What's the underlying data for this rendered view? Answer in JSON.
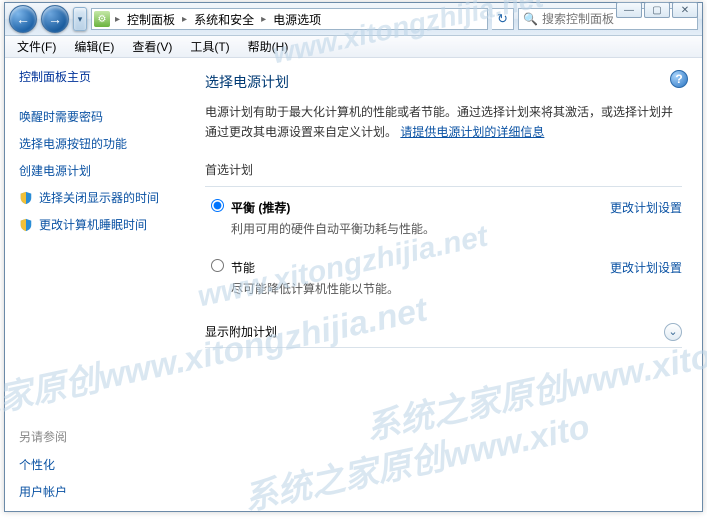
{
  "window_controls": {
    "min": "—",
    "max": "▢",
    "close": "✕"
  },
  "nav": {
    "back_glyph": "←",
    "fwd_glyph": "→",
    "drop_glyph": "▾",
    "breadcrumb": [
      "控制面板",
      "系统和安全",
      "电源选项"
    ],
    "sep": "▸",
    "refresh_glyph": "↻"
  },
  "search": {
    "placeholder": "搜索控制面板"
  },
  "menu": {
    "file": "文件(F)",
    "edit": "编辑(E)",
    "view": "查看(V)",
    "tools": "工具(T)",
    "help": "帮助(H)"
  },
  "sidebar": {
    "header": "控制面板主页",
    "links": [
      "唤醒时需要密码",
      "选择电源按钮的功能",
      "创建电源计划",
      "选择关闭显示器的时间",
      "更改计算机睡眠时间"
    ],
    "footer_header": "另请参阅",
    "footer_links": [
      "个性化",
      "用户帐户"
    ]
  },
  "content": {
    "title": "选择电源计划",
    "desc_1": "电源计划有助于最大化计算机的性能或者节能。通过选择计划来将其激活，或选择计划并通过更改其电源设置来自定义计划。",
    "desc_link": "请提供电源计划的详细信息",
    "section_preferred": "首选计划",
    "plans": [
      {
        "name": "平衡 (推荐)",
        "sub": "利用可用的硬件自动平衡功耗与性能。",
        "checked": true,
        "link": "更改计划设置"
      },
      {
        "name": "节能",
        "sub": "尽可能降低计算机性能以节能。",
        "checked": false,
        "link": "更改计划设置"
      }
    ],
    "expander": "显示附加计划",
    "chevron": "⌄",
    "help_glyph": "?"
  },
  "watermarks": [
    "之家原创www.xitongzhijia.net",
    "www.xitongzhijia.net",
    "www.xitongzhijia.net",
    "系统之家原创www.xitongzhijia.net",
    "系统之家原创www.xito"
  ]
}
